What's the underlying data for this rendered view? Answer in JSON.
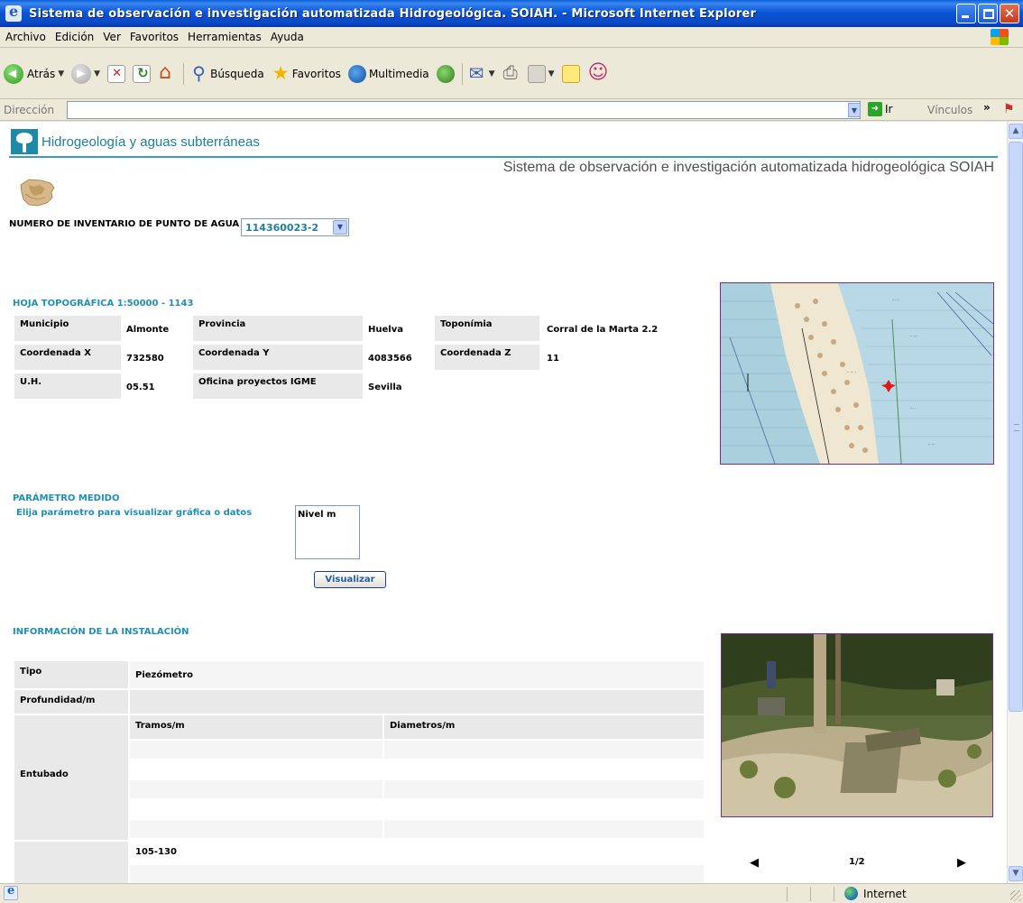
{
  "window": {
    "title": "Sistema de observación e investigación automatizada Hidrogeológica. SOIAH. - Microsoft Internet Explorer"
  },
  "menu": [
    "Archivo",
    "Edición",
    "Ver",
    "Favoritos",
    "Herramientas",
    "Ayuda"
  ],
  "toolbar": {
    "back": "Atrás",
    "search": "Búsqueda",
    "favorites": "Favoritos",
    "media": "Multimedia"
  },
  "address": {
    "label": "Dirección",
    "value": "",
    "go": "Ir",
    "links": "Vínculos"
  },
  "page": {
    "brand": "Hidrogeología y aguas subterráneas",
    "system_title": "Sistema de observación e investigación automatizada hidrogeológica SOIAH",
    "inventory_label": "NUMERO DE INVENTARIO DE PUNTO DE AGUA",
    "inventory_value": "114360023-2",
    "sheet_title": "HOJA TOPOGRÁFICA 1:50000 - 1143",
    "info": {
      "municipio_label": "Municipio",
      "municipio": "Almonte",
      "provincia_label": "Provincia",
      "provincia": "Huelva",
      "toponimia_label": "Toponímia",
      "toponimia": "Corral de la Marta 2.2",
      "x_label": "Coordenada X",
      "x": "732580",
      "y_label": "Coordenada Y",
      "y": "4083566",
      "z_label": "Coordenada Z",
      "z": "11",
      "uh_label": "U.H.",
      "uh": "05.51",
      "oficina_label": "Oficina proyectos IGME",
      "oficina": "Sevilla"
    },
    "param_title": "PARÁMETRO MEDIDO",
    "param_help": "Elija parámetro para visualizar gráfica o datos",
    "param_options": [
      "Nivel m"
    ],
    "visualize_button": "Visualizar",
    "install_title": "INFORMACIÓN DE LA INSTALACIÓN",
    "install": {
      "tipo_label": "Tipo",
      "tipo": "Piezómetro",
      "profundidad_label": "Profundidad/m",
      "profundidad": "",
      "entubado_label": "Entubado",
      "tramos_header": "Tramos/m",
      "diametros_header": "Diametros/m",
      "next_row_value": "105-130"
    },
    "photo_pager": "1/2"
  },
  "status": {
    "zone": "Internet"
  }
}
